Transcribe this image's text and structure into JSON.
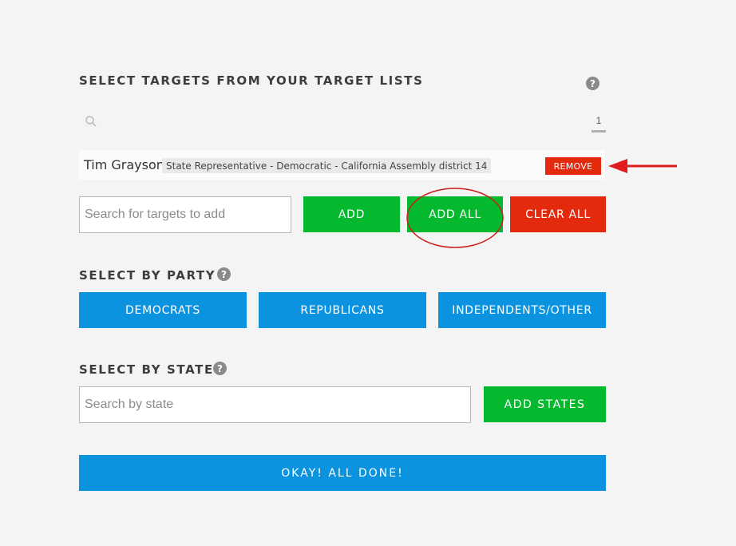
{
  "header": {
    "title": "SELECT TARGETS FROM YOUR TARGET LISTS",
    "help_glyph": "?"
  },
  "target_search": {
    "icon": "search-icon",
    "page_number": "1"
  },
  "selected_target": {
    "name": "Tim Grayson",
    "description": "State Representative - Democratic - California Assembly district 14",
    "remove_label": "REMOVE"
  },
  "add_targets": {
    "placeholder": "Search for targets to add",
    "add_label": "ADD",
    "add_all_label": "ADD ALL",
    "clear_all_label": "CLEAR ALL"
  },
  "party": {
    "title": "SELECT BY PARTY",
    "help_glyph": "?",
    "buttons": [
      "DEMOCRATS",
      "REPUBLICANS",
      "INDEPENDENTS/OTHER"
    ]
  },
  "state": {
    "title": "SELECT BY STATE",
    "help_glyph": "?",
    "placeholder": "Search by state",
    "add_label": "ADD STATES"
  },
  "done_label": "OKAY! ALL DONE!",
  "colors": {
    "green": "#05b92e",
    "red": "#e42a0c",
    "blue": "#0b93e0",
    "annotation": "#e01b1b"
  }
}
